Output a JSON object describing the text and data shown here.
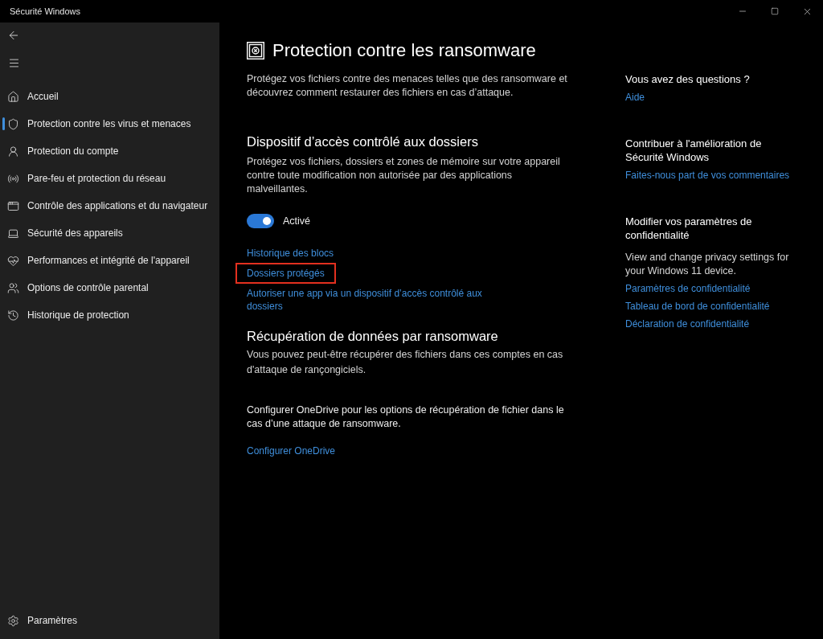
{
  "window": {
    "title": "Sécurité Windows"
  },
  "sidebar": {
    "items": [
      {
        "label": "Accueil",
        "selected": false
      },
      {
        "label": "Protection contre les virus et menaces",
        "selected": true
      },
      {
        "label": "Protection du compte",
        "selected": false
      },
      {
        "label": "Pare-feu et protection du réseau",
        "selected": false
      },
      {
        "label": "Contrôle des applications et du navigateur",
        "selected": false
      },
      {
        "label": "Sécurité des appareils",
        "selected": false
      },
      {
        "label": "Performances et intégrité de l'appareil",
        "selected": false
      },
      {
        "label": "Options de contrôle parental",
        "selected": false
      },
      {
        "label": "Historique de protection",
        "selected": false
      }
    ],
    "footer": {
      "label": "Paramètres"
    }
  },
  "page": {
    "title": "Protection contre les ransomware",
    "description": "Protégez vos fichiers contre des menaces telles que des ransomware et découvrez comment restaurer des fichiers en cas d’attaque."
  },
  "sections": [
    {
      "heading": "Dispositif d’accès contrôlé aux dossiers",
      "description": "Protégez vos fichiers, dossiers et zones de mémoire sur votre appareil contre toute modification non autorisée par des applications malveillantes.",
      "toggle": {
        "label": "Activé",
        "on": true
      },
      "links": [
        {
          "label": "Historique des blocs",
          "highlighted": false
        },
        {
          "label": "Dossiers protégés",
          "highlighted": true
        },
        {
          "label": "Autoriser une app via un dispositif d’accès contrôlé aux dossiers",
          "highlighted": false
        }
      ]
    },
    {
      "heading": "Récupération de données par ransomware",
      "description": "Vous pouvez peut-être récupérer des fichiers dans ces comptes en cas d'attaque de rançongiciels.",
      "note": "Configurer OneDrive pour les options de récupération de fichier dans le cas d’une attaque de ransomware.",
      "links": [
        {
          "label": "Configurer OneDrive",
          "highlighted": false
        }
      ]
    }
  ],
  "aside": [
    {
      "heading": "Vous avez des questions ?",
      "links": [
        "Aide"
      ]
    },
    {
      "heading": "Contribuer à l'amélioration de Sécurité Windows",
      "links": [
        "Faites-nous part de vos commentaires"
      ]
    },
    {
      "heading": "Modifier vos paramètres de confidentialité",
      "description": "View and change privacy settings for your Windows 11 device.",
      "links": [
        "Paramètres de confidentialité",
        "Tableau de bord de confidentialité",
        "Déclaration de confidentialité"
      ]
    }
  ]
}
